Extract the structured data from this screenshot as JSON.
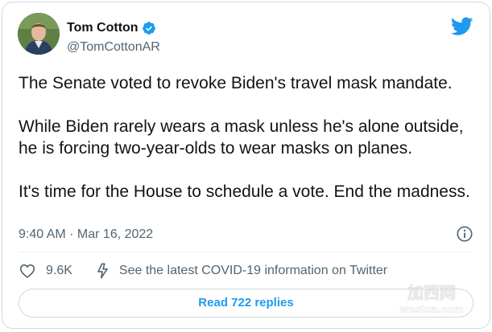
{
  "author": {
    "display_name": "Tom Cotton",
    "handle": "@TomCottonAR",
    "verified": true
  },
  "tweet": {
    "paragraphs": [
      "The Senate voted to revoke Biden's travel mask mandate.",
      "While Biden rarely wears a mask unless he's alone outside, he is forcing two-year-olds to wear masks on planes.",
      "It's time for the House to schedule a vote. End the madness."
    ],
    "timestamp": "9:40 AM · Mar 16, 2022"
  },
  "actions": {
    "like_count": "9.6K",
    "covid_link": "See the latest COVID-19 information on Twitter"
  },
  "replies_button": "Read 722 replies",
  "watermark": {
    "top": "加西网",
    "bottom": "westca.com"
  },
  "icons": {
    "verified": "verified-badge-icon",
    "brand": "twitter-bird-icon",
    "info": "info-icon",
    "like": "heart-icon",
    "covid": "lightning-bolt-icon"
  },
  "colors": {
    "brand_blue": "#1d9bf0",
    "text_primary": "#0f1419",
    "text_secondary": "#536471",
    "border": "#cfd9de"
  }
}
